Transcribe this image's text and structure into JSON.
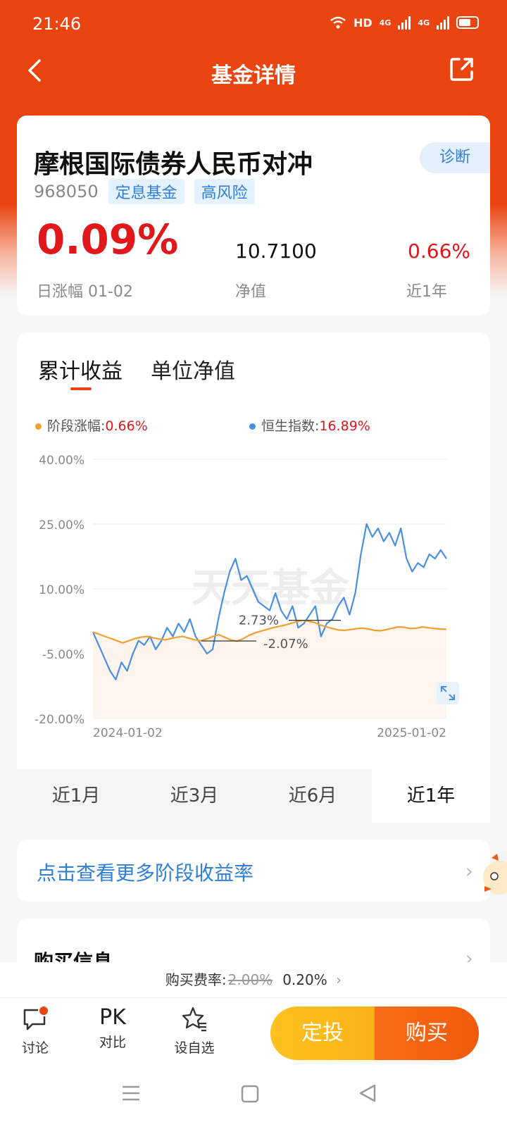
{
  "status_bar": {
    "time": "21:46",
    "network": "HD",
    "signal1": "4G",
    "signal2": "4G"
  },
  "nav": {
    "title": "基金详情"
  },
  "fund": {
    "name": "摩根国际债券人民币对冲",
    "code": "968050",
    "tags": [
      "定息基金",
      "高风险"
    ],
    "diagnose_label": "诊断",
    "daily_change": "0.09%",
    "daily_change_label": "日涨幅 01-02",
    "nav_value": "10.7100",
    "nav_label": "净值",
    "year_return": "0.66%",
    "year_return_label": "近1年"
  },
  "chart_section": {
    "tabs": [
      "累计收益",
      "单位净值"
    ],
    "active_tab": 0,
    "legend": [
      {
        "label": "阶段涨幅:",
        "value": "0.66%",
        "color": "#f0a030"
      },
      {
        "label": "恒生指数:",
        "value": "16.89%",
        "color": "#4a90e2"
      }
    ],
    "periods": [
      "近1月",
      "近3月",
      "近6月",
      "近1年"
    ],
    "active_period": 3
  },
  "chart_data": {
    "type": "line",
    "x_start": "2024-01-02",
    "x_end": "2025-01-02",
    "y_ticks": [
      "40.00%",
      "25.00%",
      "10.00%",
      "-5.00%",
      "-20.00%"
    ],
    "ylim": [
      -20,
      40
    ],
    "watermark": "天天基金",
    "annotations": [
      {
        "text": "2.73%",
        "value": 2.73
      },
      {
        "text": "-2.07%",
        "value": -2.07
      }
    ],
    "series": [
      {
        "name": "阶段涨幅",
        "color": "#f0a030",
        "values": [
          0,
          -0.5,
          -1,
          -1.5,
          -2,
          -2.5,
          -2,
          -1.5,
          -1.2,
          -1,
          -1.3,
          -1.6,
          -1.8,
          -1.5,
          -1.2,
          -1,
          -1.4,
          -1.8,
          -2,
          -1.6,
          -1,
          -0.6,
          -1.2,
          -1.8,
          -2.1,
          -1.6,
          -0.8,
          -0.2,
          0.2,
          0.6,
          1,
          1.3,
          1.6,
          2,
          2.4,
          2.7,
          2.5,
          2.2,
          1.6,
          1.2,
          0.8,
          0.5,
          0.4,
          0.6,
          0.8,
          0.9,
          0.7,
          0.4,
          0.3,
          0.6,
          0.9,
          1.2,
          1.1,
          0.8,
          0.9,
          1.2,
          1.0,
          0.8,
          0.7,
          0.66
        ]
      },
      {
        "name": "恒生指数",
        "color": "#4a90e2",
        "values": [
          0,
          -3,
          -6,
          -9,
          -11,
          -7,
          -9,
          -5,
          -2,
          -3,
          -1,
          -4,
          -2,
          1,
          -1,
          2,
          0,
          3,
          -1,
          -3,
          -5,
          -4,
          3,
          9,
          14,
          17,
          12,
          13,
          10,
          7,
          6,
          5,
          9,
          5,
          3,
          6,
          1,
          2,
          4,
          6,
          -1,
          2,
          3,
          6,
          8,
          4,
          9,
          18,
          25,
          22,
          24,
          21,
          23,
          20,
          24,
          17,
          14,
          16,
          15,
          18,
          17,
          19,
          17
        ]
      }
    ]
  },
  "more_returns": {
    "label": "点击查看更多阶段收益率"
  },
  "buy_info": {
    "title": "购买信息"
  },
  "fee": {
    "label": "购买费率:",
    "old_rate": "2.00%",
    "new_rate": "0.20%"
  },
  "bottom_bar": {
    "discuss": "讨论",
    "compare_icon": "PK",
    "compare": "对比",
    "watchlist": "设自选",
    "sip_button": "定投",
    "buy_button": "购买"
  }
}
